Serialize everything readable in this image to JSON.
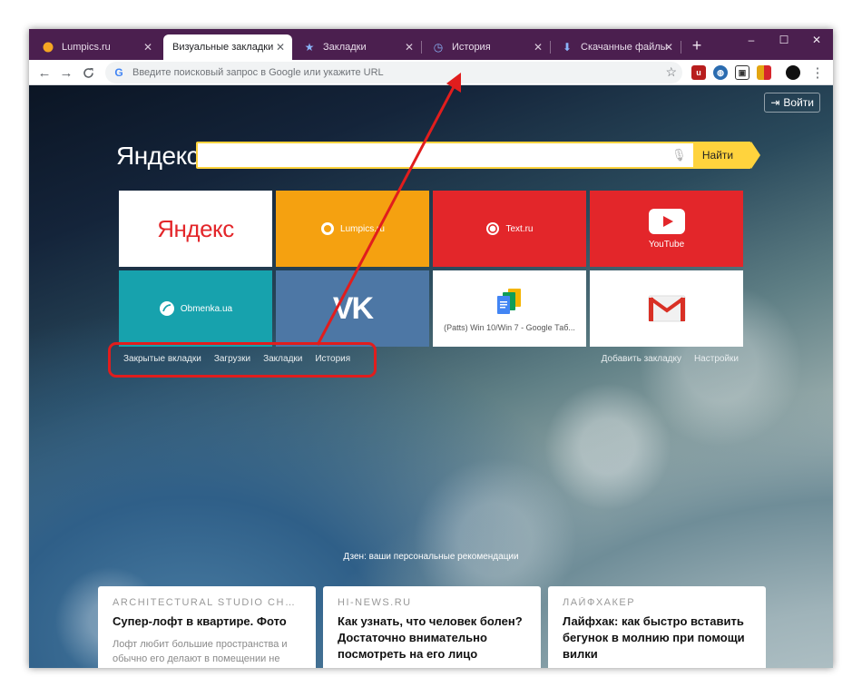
{
  "tabs": [
    {
      "label": "Lumpics.ru",
      "icon": "lumpics-favicon",
      "active": false
    },
    {
      "label": "Визуальные закладки",
      "icon": "",
      "active": true
    },
    {
      "label": "Закладки",
      "icon": "star-icon",
      "active": false
    },
    {
      "label": "История",
      "icon": "history-icon",
      "active": false
    },
    {
      "label": "Скачанные файлы",
      "icon": "download-icon",
      "active": false
    }
  ],
  "window_controls": {
    "new_tab": "+",
    "minimize": "–",
    "maximize": "☐",
    "close": "✕"
  },
  "toolbar": {
    "back": "←",
    "forward": "→",
    "reload": "C",
    "omnibox_placeholder": "Введите поисковый запрос в Google или укажите URL",
    "google_icon": "G",
    "star": "☆",
    "menu": "⋮"
  },
  "extensions": [
    {
      "name": "ublock-icon",
      "color": "#b81e1e"
    },
    {
      "name": "globe-icon",
      "color": "#2b6cb0"
    },
    {
      "name": "cube-icon",
      "color": "#333333"
    },
    {
      "name": "bookmark-flag-icon",
      "color": "#e3a511"
    },
    {
      "name": "profile-avatar",
      "color": "#111111"
    }
  ],
  "page": {
    "login_label": "Войти",
    "logo": "Яндекс",
    "search_button": "Найти",
    "tiles": [
      {
        "label": "Яндекс",
        "bg": "#ffffff",
        "type": "logo"
      },
      {
        "label": "Lumpics.ru",
        "bg": "#f5a110",
        "type": "text"
      },
      {
        "label": "Text.ru",
        "bg": "#e3262a",
        "type": "text"
      },
      {
        "label": "YouTube",
        "bg": "#e3262a",
        "type": "youtube"
      },
      {
        "label": "Obmenka.ua",
        "bg": "#17a2ad",
        "type": "text"
      },
      {
        "label": "VK",
        "bg": "#4d77a5",
        "type": "vk"
      },
      {
        "label": "(Patts) Win 10/Win 7 - Google Таб...",
        "bg": "#ffffff",
        "type": "gdocs"
      },
      {
        "label": "Gmail",
        "bg": "#ffffff",
        "type": "gmail"
      }
    ],
    "left_links": [
      "Закрытые вкладки",
      "Загрузки",
      "Закладки",
      "История"
    ],
    "right_links": [
      "Добавить закладку",
      "Настройки"
    ],
    "dzen_caption": "Дзен: ваши персональные рекомендации",
    "cards": [
      {
        "source": "ARCHITECTURAL STUDIO CHA...",
        "title": "Супер-лофт в квартире. Фото",
        "desc": "Лофт любит большие пространства и обычно его делают в помещении не"
      },
      {
        "source": "HI-NEWS.RU",
        "title": "Как узнать, что человек болен? Достаточно внимательно посмотреть на его лицо",
        "desc": ""
      },
      {
        "source": "ЛАЙФХАКЕР",
        "title": "Лайфхак: как быстро вставить бегунок в молнию при помощи вилки",
        "desc": ""
      }
    ]
  },
  "colors": {
    "tabstrip": "#4b1f4f",
    "search_accent": "#ffd33d",
    "annotation": "#e11d1d"
  }
}
